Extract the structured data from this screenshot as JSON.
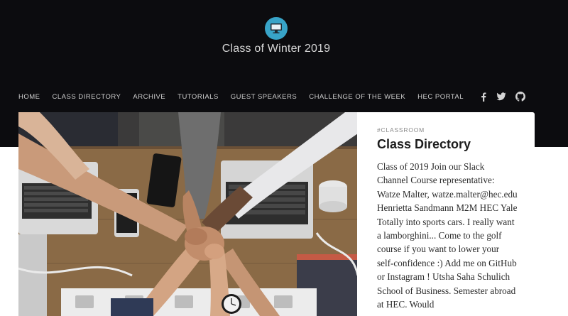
{
  "site": {
    "title": "Class of Winter 2019",
    "logo_icon": "computer-monitor-icon",
    "accent_color": "#38a4c8"
  },
  "nav": {
    "items": [
      {
        "label": "HOME"
      },
      {
        "label": "CLASS DIRECTORY"
      },
      {
        "label": "ARCHIVE"
      },
      {
        "label": "TUTORIALS"
      },
      {
        "label": "GUEST SPEAKERS"
      },
      {
        "label": "CHALLENGE OF THE WEEK"
      },
      {
        "label": "HEC PORTAL"
      }
    ],
    "social": [
      {
        "icon": "facebook-icon"
      },
      {
        "icon": "twitter-icon"
      },
      {
        "icon": "github-icon"
      }
    ]
  },
  "hero": {
    "image_icon": "team-fist-bump-photo"
  },
  "post": {
    "tag": "#CLASSROOM",
    "title": "Class Directory",
    "excerpt": "Class of 2019 Join our Slack Channel Course representative: Watze Malter, watze.malter@hec.edu Henrietta Sandmann M2M HEC Yale Totally into sports cars. I really want a lamborghini... Come to the golf course if you want to lower your self-confidence :) Add me on GitHub or Instagram ! Utsha Saha Schulich School of Business. Semester abroad at HEC. Would"
  }
}
